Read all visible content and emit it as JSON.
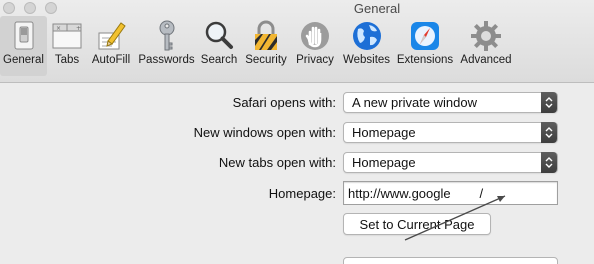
{
  "window": {
    "title": "General"
  },
  "toolbar": {
    "items": [
      {
        "label": "General",
        "icon": "general-switch-icon",
        "selected": true
      },
      {
        "label": "Tabs",
        "icon": "tabs-icon",
        "selected": false
      },
      {
        "label": "AutoFill",
        "icon": "autofill-pencil-icon",
        "selected": false
      },
      {
        "label": "Passwords",
        "icon": "key-icon",
        "selected": false
      },
      {
        "label": "Search",
        "icon": "magnifier-icon",
        "selected": false
      },
      {
        "label": "Security",
        "icon": "padlock-icon",
        "selected": false
      },
      {
        "label": "Privacy",
        "icon": "hand-icon",
        "selected": false
      },
      {
        "label": "Websites",
        "icon": "globe-icon",
        "selected": false
      },
      {
        "label": "Extensions",
        "icon": "compass-icon",
        "selected": false
      },
      {
        "label": "Advanced",
        "icon": "gear-icon",
        "selected": false
      }
    ]
  },
  "settings": {
    "safari_opens_with": {
      "label": "Safari opens with:",
      "value": "A new private window"
    },
    "new_windows_open_with": {
      "label": "New windows open with:",
      "value": "Homepage"
    },
    "new_tabs_open_with": {
      "label": "New tabs open with:",
      "value": "Homepage"
    },
    "homepage": {
      "label": "Homepage:",
      "value": "http://www.google        /"
    },
    "set_current_page": {
      "label": "Set to Current Page"
    }
  },
  "colors": {
    "accent_blue": "#1a73e8",
    "popup_arrow": "#4a4a4a",
    "selected_tab": "#d2d2d2"
  }
}
